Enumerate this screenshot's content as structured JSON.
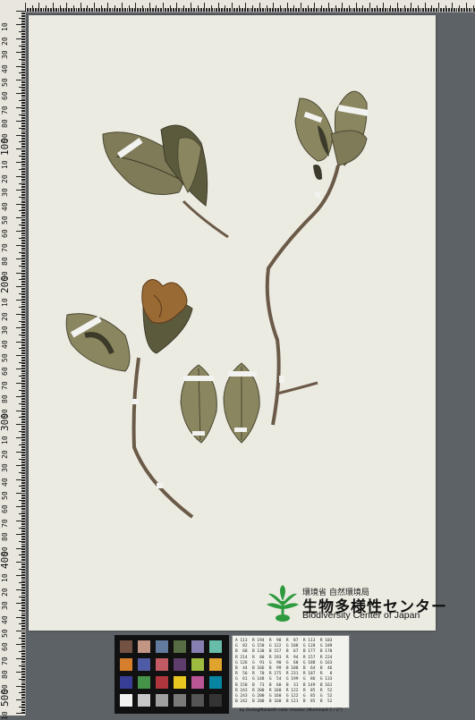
{
  "ruler": {
    "vertical_labels": [
      "10",
      "20",
      "30",
      "40",
      "50",
      "60",
      "70",
      "80",
      "90",
      "100",
      "10",
      "20",
      "30",
      "40",
      "50",
      "60",
      "70",
      "80",
      "90",
      "200",
      "10",
      "20",
      "30",
      "40",
      "50",
      "60",
      "70",
      "80",
      "90",
      "300",
      "10",
      "20",
      "30",
      "40",
      "50",
      "60",
      "70",
      "80",
      "90",
      "400",
      "10",
      "20",
      "30",
      "40",
      "50",
      "60",
      "70",
      "80",
      "90",
      "500",
      "10"
    ]
  },
  "label": {
    "org_ja": "環境省 自然環境局",
    "center_ja": "生物多様性センター",
    "center_en": "Biodiversity Center of Japan"
  },
  "colors": {
    "leaf_dark": "#5c5a3c",
    "leaf_light": "#8a8660",
    "stem": "#6b5a48",
    "flower": "#9a6a35",
    "logo_green": "#2e9a3e"
  },
  "color_chart": {
    "swatches": [
      "#735244",
      "#c29682",
      "#627a9d",
      "#576c43",
      "#8580b1",
      "#67bdaa",
      "#d67e2c",
      "#505ba6",
      "#c15a63",
      "#5e3c6c",
      "#9dbc40",
      "#e0a32e",
      "#383d96",
      "#469449",
      "#af363c",
      "#e7c71f",
      "#bb5695",
      "#0885a1",
      "#f3f3f2",
      "#c8c8c8",
      "#a0a0a0",
      "#7a7a79",
      "#555555",
      "#343434"
    ]
  },
  "grey_card": {
    "rows": [
      "A 113  R 194  R  98  R  87  R 113  R 103",
      "G  82  G 150  G 122  G 108  G 128  G 189",
      "B  68  B 130  B 157  B  67  B 177  B 170",
      "R 214  R  80  R 193  R  94  R 157  R 224",
      "G 126  G  91  G  90  G  60  G 188  G 163",
      "B  44  B 166  B  99  B 108  B  64  B  46",
      "R  56  R  70  R 175  R 231  R 187  R   8",
      "G  61  G 148  G  54  G 199  G  86  G 133",
      "B 150  B  73  B  60  B  31  B 149  B 161",
      "R 243  R 200  R 160  R 122  R  85  R  52",
      "G 243  G 200  G 160  G 122  G  85  G  52",
      "B 242  B 200  B 160  B 121  B  85  B  52"
    ]
  },
  "caption": "by GretagMacbeth color checker (Illuminant C / 2°)"
}
